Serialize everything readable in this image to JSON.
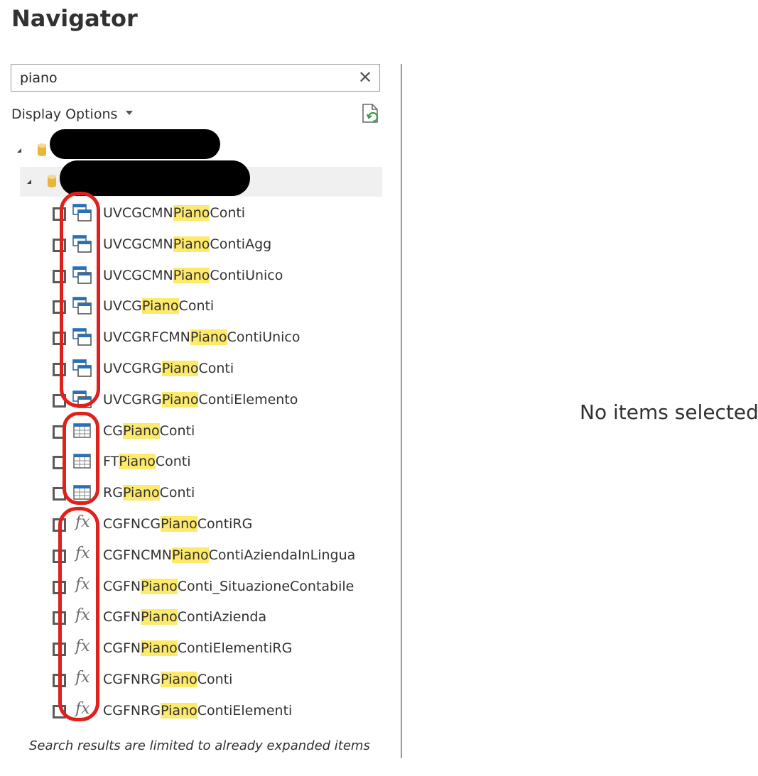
{
  "title": "Navigator",
  "search": {
    "value": "piano",
    "clear_icon": "close-icon"
  },
  "display_options": {
    "label": "Display Options"
  },
  "refresh_icon": "refresh-document-icon",
  "tree": {
    "server_icon": "database-icon",
    "database_icon": "database-icon"
  },
  "items": [
    {
      "type": "view",
      "pre": "UVCGCMN",
      "match": "Piano",
      "post": "Conti"
    },
    {
      "type": "view",
      "pre": "UVCGCMN",
      "match": "Piano",
      "post": "ContiAgg"
    },
    {
      "type": "view",
      "pre": "UVCGCMN",
      "match": "Piano",
      "post": "ContiUnico"
    },
    {
      "type": "view",
      "pre": "UVCG",
      "match": "Piano",
      "post": "Conti"
    },
    {
      "type": "view",
      "pre": "UVCGRFCMN",
      "match": "Piano",
      "post": "ContiUnico"
    },
    {
      "type": "view",
      "pre": "UVCGRG",
      "match": "Piano",
      "post": "Conti"
    },
    {
      "type": "view",
      "pre": "UVCGRG",
      "match": "Piano",
      "post": "ContiElemento"
    },
    {
      "type": "table",
      "pre": "CG",
      "match": "Piano",
      "post": "Conti"
    },
    {
      "type": "table",
      "pre": "FT",
      "match": "Piano",
      "post": "Conti"
    },
    {
      "type": "table",
      "pre": "RG",
      "match": "Piano",
      "post": "Conti"
    },
    {
      "type": "function",
      "pre": "CGFNCG",
      "match": "Piano",
      "post": "ContiRG"
    },
    {
      "type": "function",
      "pre": "CGFNCMN",
      "match": "Piano",
      "post": "ContiAziendaInLingua"
    },
    {
      "type": "function",
      "pre": "CGFN",
      "match": "Piano",
      "post": "Conti_SituazioneContabile"
    },
    {
      "type": "function",
      "pre": "CGFN",
      "match": "Piano",
      "post": "ContiAzienda"
    },
    {
      "type": "function",
      "pre": "CGFN",
      "match": "Piano",
      "post": "ContiElementiRG"
    },
    {
      "type": "function",
      "pre": "CGFNRG",
      "match": "Piano",
      "post": "Conti"
    },
    {
      "type": "function",
      "pre": "CGFNRG",
      "match": "Piano",
      "post": "ContiElementi"
    }
  ],
  "fx_symbol": "fx",
  "footnote": "Search results are limited to already expanded items",
  "preview": {
    "empty_message": "No items selected"
  },
  "colors": {
    "highlight": "#fde96a",
    "annotation": "#e0201b",
    "icon_blue": "#2b6fb6"
  }
}
